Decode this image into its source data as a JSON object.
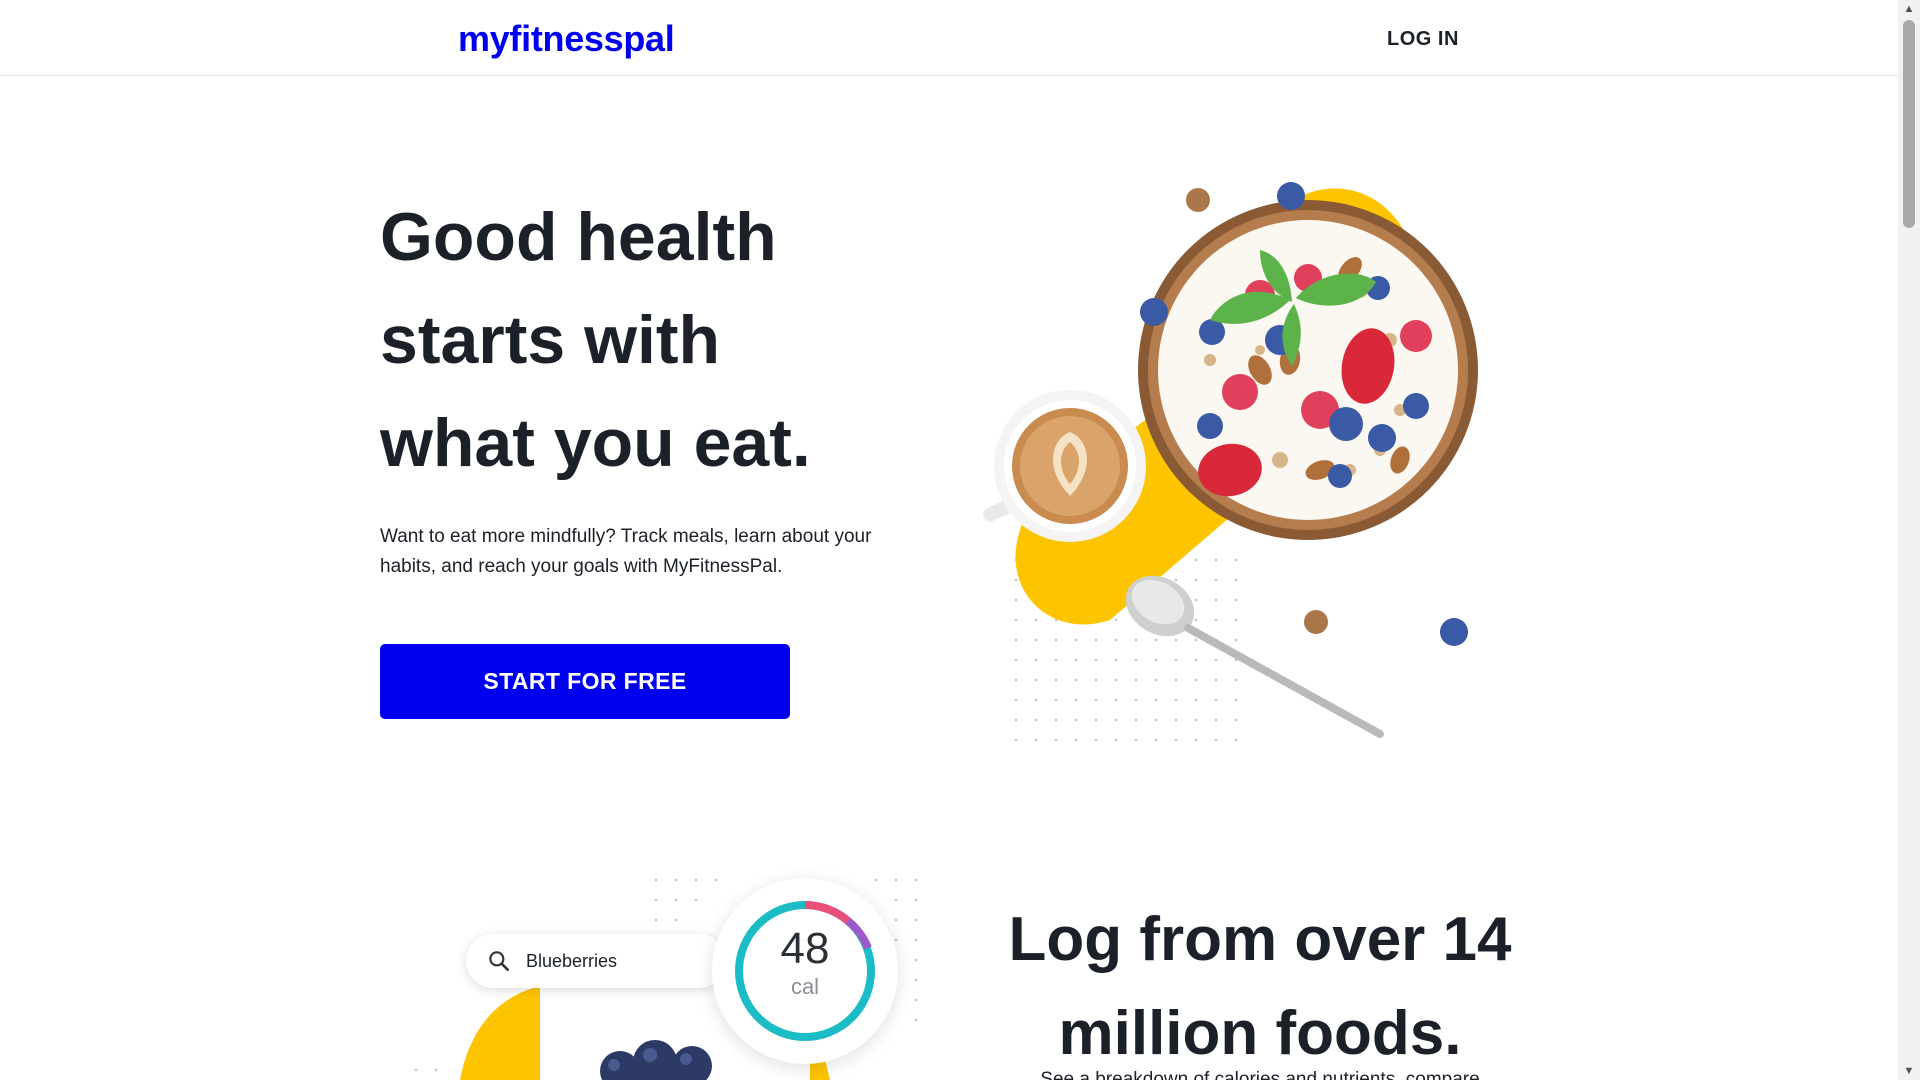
{
  "header": {
    "logo": "myfitnesspal",
    "login_label": "LOG IN"
  },
  "hero": {
    "title_lines": [
      "Good health",
      "starts with",
      "what you eat."
    ],
    "description": "Want to eat more mindfully? Track meals, learn about your habits, and reach your goals with MyFitnessPal.",
    "cta_label": "START FOR FREE"
  },
  "section2": {
    "search_text": "Blueberries",
    "calories_value": "48",
    "calories_unit": "cal",
    "title_lines": [
      "Log from over 14",
      "million foods."
    ],
    "description_partial": "See a breakdown of calories and nutrients, compare"
  },
  "colors": {
    "brand_blue": "#0000ee",
    "text_dark": "#1b2029",
    "accent_yellow": "#fdc500",
    "ring_teal": "#1bbcc5",
    "ring_pink": "#e8507a",
    "ring_purple": "#9b59c9"
  },
  "icons": {
    "search": "search-icon",
    "scroll_up": "chevron-up-icon",
    "scroll_down": "chevron-down-icon"
  }
}
